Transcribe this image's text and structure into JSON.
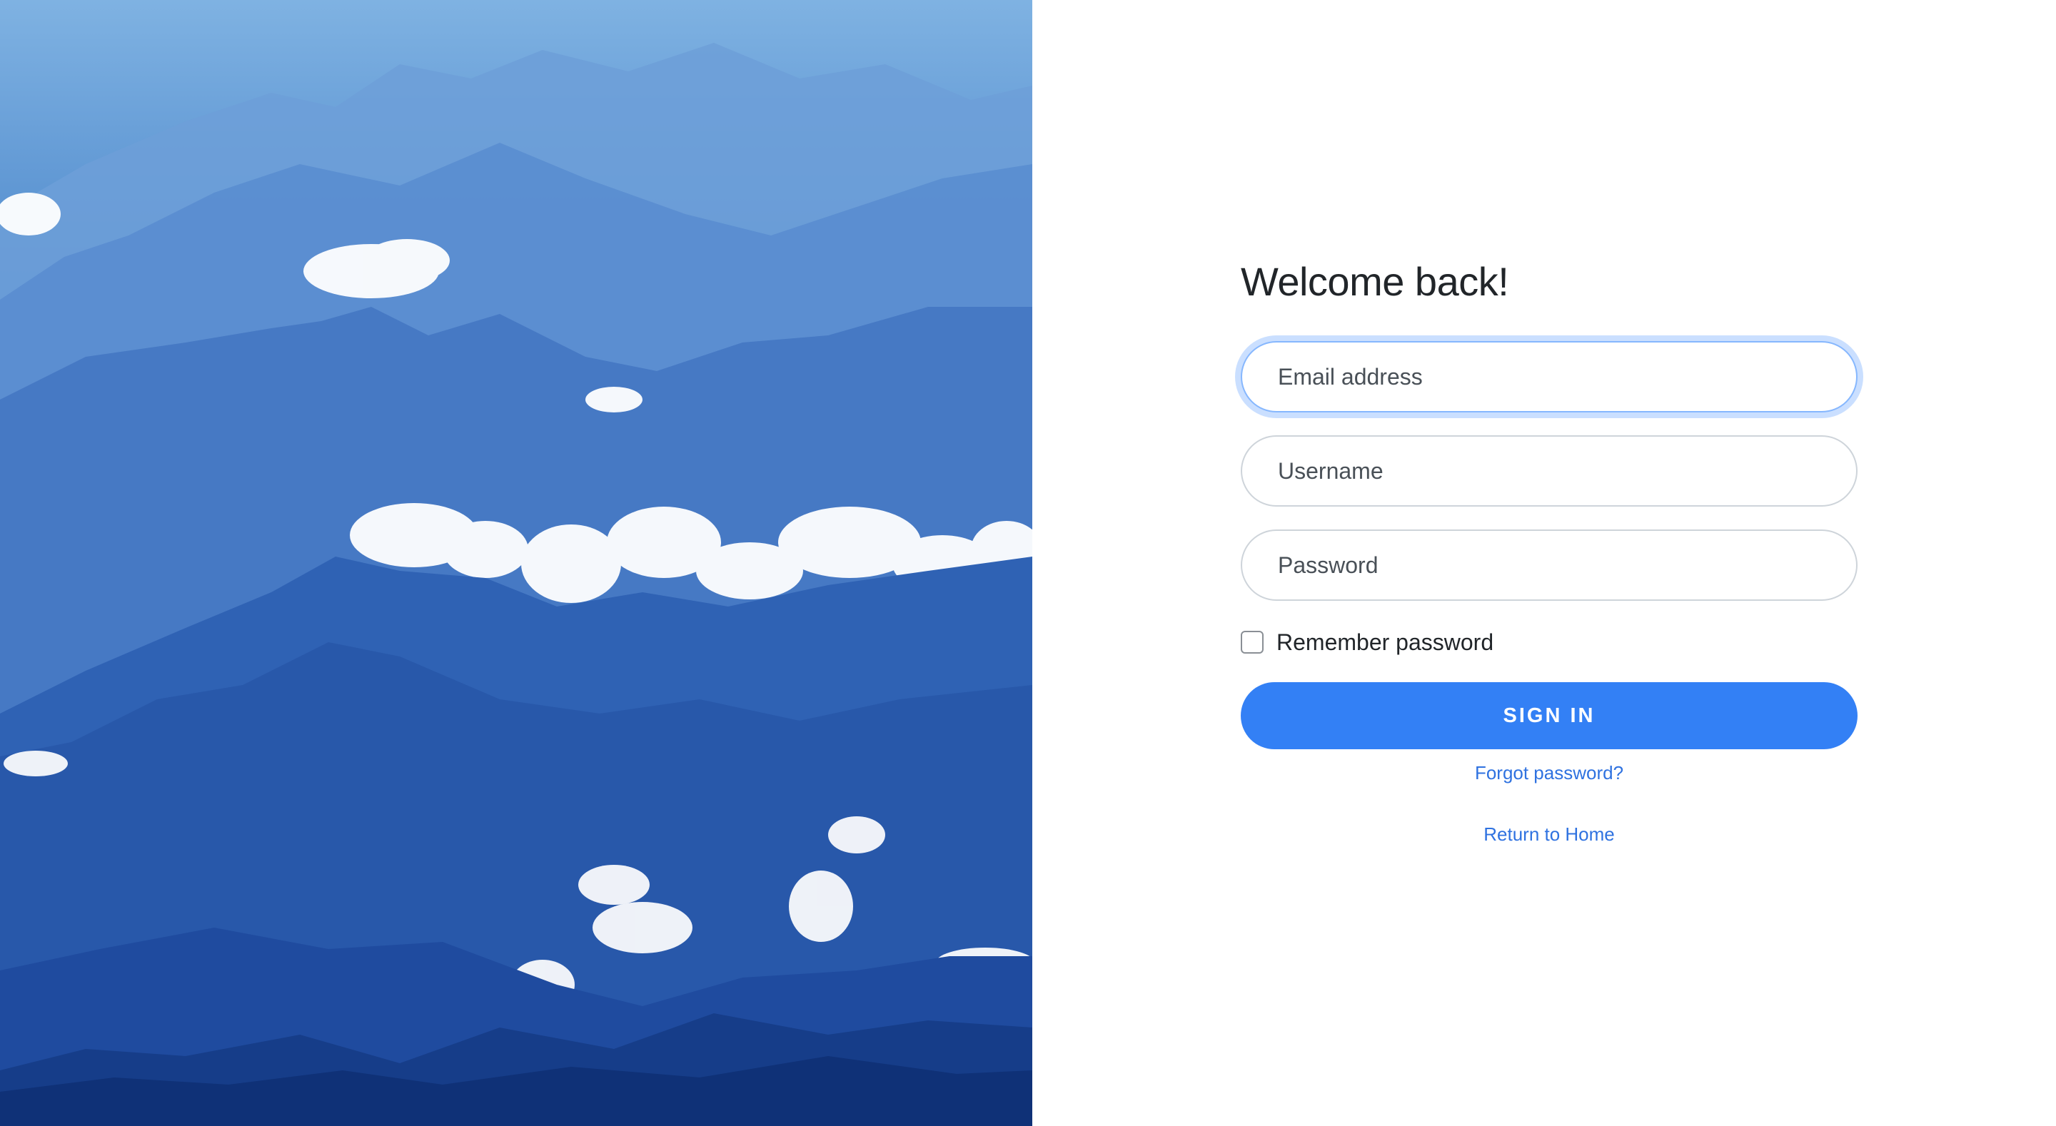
{
  "hero": {
    "image": "mountain-landscape-image",
    "colors": {
      "sky": "#7fb2e2",
      "mid": "#3f78c4",
      "deep": "#173c87",
      "cloud": "#ffffff"
    }
  },
  "login": {
    "title": "Welcome back!",
    "email_placeholder": "Email address",
    "username_placeholder": "Username",
    "password_placeholder": "Password",
    "remember_label": "Remember password",
    "signin_label": "SIGN IN",
    "forgot_label": "Forgot password?",
    "home_label": "Return to Home"
  },
  "colors": {
    "accent": "#3380f5",
    "link": "#2f72e0",
    "focus_ring": "#86b7fe",
    "text": "#212529"
  }
}
